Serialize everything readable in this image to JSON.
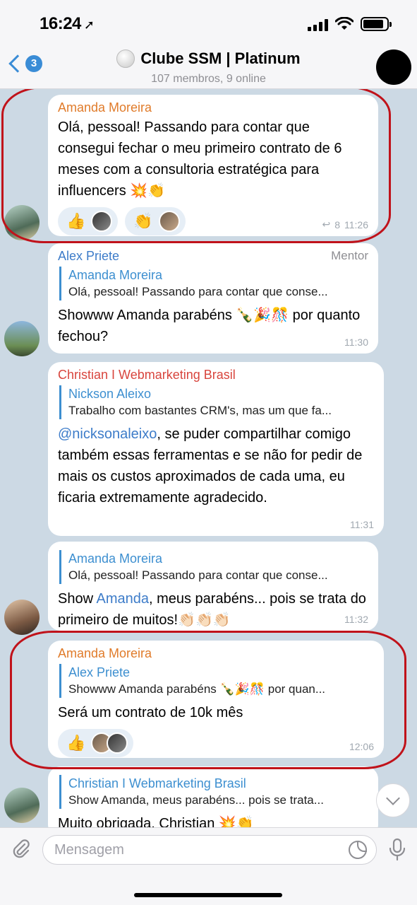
{
  "status_bar": {
    "time": "16:24",
    "location_glyph": "➚"
  },
  "header": {
    "back_badge": "3",
    "title": "Clube SSM | Platinum",
    "subtitle": "107 membros, 9 online"
  },
  "messages": [
    {
      "sender": "Amanda Moreira",
      "text": "Olá, pessoal! Passando para contar que consegui fechar o meu primeiro contrato de 6 meses com a consultoria estratégica para influencers 💥👏",
      "reactions": [
        "👍",
        "👏"
      ],
      "replies_count": "8",
      "time": "11:26"
    },
    {
      "sender": "Alex Priete",
      "role": "Mentor",
      "reply_name": "Amanda Moreira",
      "reply_text": "Olá, pessoal! Passando para contar que conse...",
      "text": "Showww Amanda parabéns 🍾🎉🎊 por quanto fechou?",
      "time": "11:30"
    },
    {
      "sender": "Christian I Webmarketing Brasil",
      "reply_name": "Nickson Aleixo",
      "reply_text": "Trabalho com bastantes CRM's, mas um que fa...",
      "mention": "@nicksonaleixo",
      "text": ", se puder compartilhar comigo também essas ferramentas e se não for pedir de mais os custos aproximados de cada uma, eu ficaria extremamente agradecido.",
      "time": "11:31"
    },
    {
      "reply_name": "Amanda Moreira",
      "reply_text": "Olá, pessoal! Passando para contar que conse...",
      "text_before": "Show ",
      "mention": "Amanda",
      "text": ", meus parabéns... pois se trata do primeiro de muitos!👏🏻👏🏻👏🏻",
      "time": "11:32"
    },
    {
      "sender": "Amanda Moreira",
      "reply_name": "Alex Priete",
      "reply_text": "Showww Amanda parabéns 🍾🎉🎊 por quan...",
      "text": "Será um contrato de 10k mês",
      "reactions": [
        "👍"
      ],
      "time": "12:06"
    },
    {
      "reply_name": "Christian I Webmarketing Brasil",
      "reply_text": "Show Amanda, meus parabéns... pois se trata...",
      "text": "Muito obrigada, Christian 💥👏"
    }
  ],
  "composer": {
    "placeholder": "Mensagem"
  },
  "colors": {
    "accent": "#3a8cd6",
    "annotation": "#c0121a",
    "chat_bg": "#ccd9e4"
  }
}
